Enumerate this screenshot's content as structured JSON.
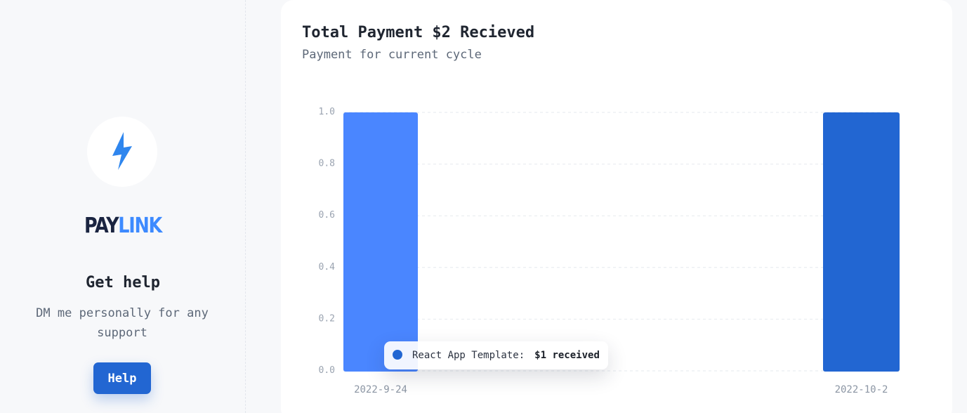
{
  "sidebar": {
    "brand_part1": "PAY",
    "brand_part2": "LINK",
    "help_title": "Get help",
    "help_description": "DM me personally for any support",
    "help_button": "Help"
  },
  "card": {
    "title": "Total Payment $2 Recieved",
    "subtitle": "Payment for current cycle"
  },
  "tooltip": {
    "label": "React App Template:",
    "value": "$1 received"
  },
  "colors": {
    "accent": "#2266d2",
    "bar_light": "#4a86ff",
    "brand_dark": "#1a2440",
    "brand_light": "#3d8aff"
  },
  "chart_data": {
    "type": "bar",
    "categories": [
      "2022-9-24",
      "2022-10-2"
    ],
    "series": [
      {
        "values": [
          1,
          1
        ]
      }
    ],
    "bar_colors": [
      "#4a86ff",
      "#2266d2"
    ],
    "ylim": [
      0,
      1
    ],
    "yticks": [
      "0.0",
      "0.2",
      "0.4",
      "0.6",
      "0.8",
      "1.0"
    ],
    "grid": true
  }
}
